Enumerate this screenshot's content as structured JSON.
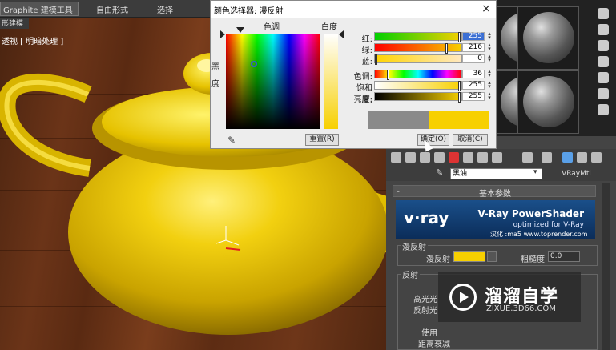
{
  "ribbon": {
    "tabs": [
      "Graphite 建模工具",
      "自由形式",
      "选择"
    ],
    "subtab": "形建模"
  },
  "viewport": {
    "label": "透视 [ 明暗处理 ]"
  },
  "dialog": {
    "title": "颜色选择器: 漫反射",
    "close": "×",
    "hue_label": "色调",
    "white_label": "白度",
    "black_label": "黑度",
    "sliders": [
      {
        "label": "红:",
        "value": "255",
        "fraction": 1.0,
        "gradient": "linear-gradient(to right,#00d000,#f7d000)",
        "selected": true
      },
      {
        "label": "绿:",
        "value": "216",
        "fraction": 0.847,
        "gradient": "linear-gradient(to right,#ff0000,#f7d000)",
        "selected": false
      },
      {
        "label": "蓝:",
        "value": "0",
        "fraction": 0.0,
        "gradient": "linear-gradient(to right,#ffd400,#ffe8c0)",
        "selected": false
      },
      {
        "label": "色调:",
        "value": "36",
        "fraction": 0.141,
        "gradient": "linear-gradient(to right,#f00,#ff0,#0f0,#0ff,#00f,#f0f,#f00)",
        "selected": false
      },
      {
        "label": "饱和度:",
        "value": "255",
        "fraction": 1.0,
        "gradient": "linear-gradient(to right,#ffffff,#f7d000)",
        "selected": false
      },
      {
        "label": "亮度:",
        "value": "255",
        "fraction": 1.0,
        "gradient": "linear-gradient(to right,#000000,#f7d000)",
        "selected": false
      }
    ],
    "old_color": "#8a8a8a",
    "new_color": "#f7d000",
    "reset_label": "重置(R)",
    "ok_label": "确定(O)",
    "cancel_label": "取消(C)"
  },
  "material": {
    "name": "黑油",
    "type": "VRayMtl",
    "rollout_title": "基本参数",
    "rollout_sign": "-",
    "vray_logo": "v·ray",
    "vray_title": "V-Ray PowerShader",
    "vray_sub": "optimized for V-Ray",
    "vray_credit": "汉化 :ma5   www.toprender.com",
    "diffuse_group": "漫反射",
    "diffuse_label": "漫反射",
    "diffuse_color": "#f7d000",
    "roughness_label": "粗糙度",
    "roughness_value": "0.0",
    "reflect_group": "反射",
    "reflect_rows": [
      "高光光",
      "反射光",
      "使用",
      "距离衰减"
    ]
  },
  "watermark": {
    "title": "溜溜自学",
    "url": "ZIXUE.3D66.COM"
  }
}
